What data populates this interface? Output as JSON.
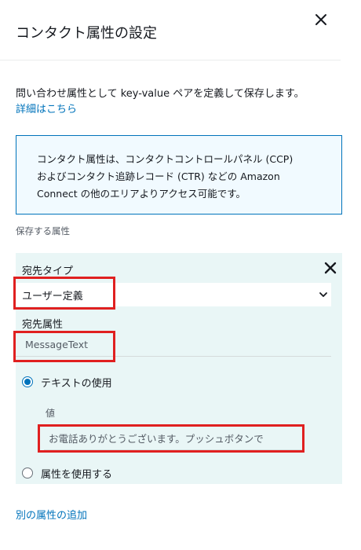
{
  "header": {
    "title": "コンタクト属性の設定",
    "close_icon": "close-icon"
  },
  "intro": {
    "description": "問い合わせ属性として key-value ペアを定義して保存します。",
    "details_link": "詳細はこちら"
  },
  "info_box": {
    "lines": [
      "コンタクト属性は、コンタクトコントロールパネル (CCP)",
      "およびコンタクト追跡レコード (CTR) などの Amazon",
      "Connect の他のエリアよりアクセス可能です。"
    ]
  },
  "attributes_section": {
    "label": "保存する属性",
    "destination_type": {
      "label": "宛先タイプ",
      "selected": "ユーザー定義"
    },
    "destination_attribute": {
      "label": "宛先属性",
      "value": "MessageText"
    },
    "options": [
      {
        "label": "テキストの使用",
        "checked": true
      },
      {
        "label": "属性を使用する",
        "checked": false
      }
    ],
    "value_field": {
      "label": "値",
      "value": "お電話ありがとうございます。プッシュボタンで"
    }
  },
  "footer": {
    "add_link": "別の属性の追加"
  },
  "colors": {
    "accent": "#0073bb",
    "highlight": "#e02020",
    "card_background": "#e9f6f6",
    "info_background": "#f1faff"
  }
}
